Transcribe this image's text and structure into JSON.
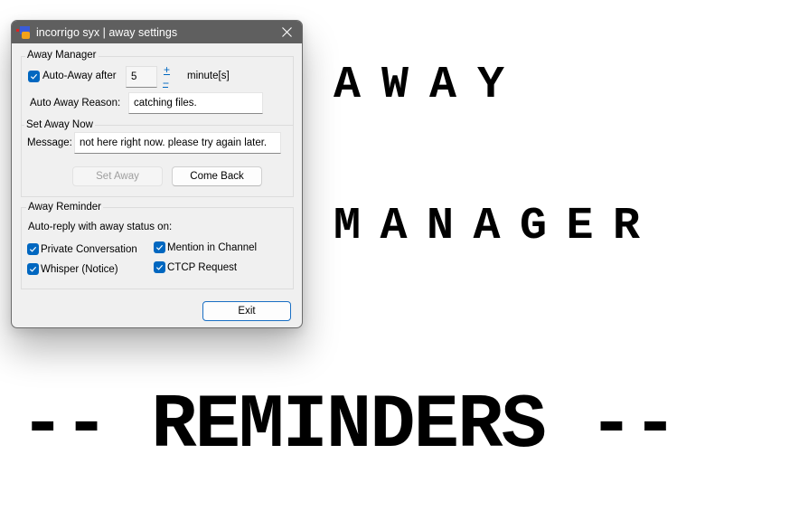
{
  "background": {
    "line1": "AWAY",
    "line2": "MANAGER",
    "line3": "-- REMINDERS --"
  },
  "window": {
    "title": "incorrigo syx | away settings",
    "icon": "app-icon",
    "close_icon": "close-icon"
  },
  "away_manager": {
    "group_title": "Away Manager",
    "auto_away_checkbox": {
      "label": "Auto-Away after",
      "checked": true
    },
    "minutes_value": "5",
    "increment_label": "+",
    "decrement_label": "--",
    "minutes_unit": "minute[s]",
    "reason_label": "Auto Away Reason:",
    "reason_value": "catching files."
  },
  "set_away_now": {
    "section_title": "Set Away Now",
    "message_label": "Message:",
    "message_value": "not here right now. please try again later.",
    "set_away_button": {
      "label": "Set Away",
      "enabled": false
    },
    "come_back_button": {
      "label": "Come Back",
      "enabled": true
    }
  },
  "away_reminder": {
    "group_title": "Away Reminder",
    "description": "Auto-reply with away status on:",
    "options": [
      {
        "label": "Private Conversation",
        "checked": true
      },
      {
        "label": "Mention in Channel",
        "checked": true
      },
      {
        "label": "Whisper (Notice)",
        "checked": true
      },
      {
        "label": "CTCP Request",
        "checked": true
      }
    ]
  },
  "footer": {
    "exit_label": "Exit"
  },
  "colors": {
    "titlebar": "#5f5f5f",
    "dialog_bg": "#f0f0f0",
    "accent": "#0067c0"
  }
}
